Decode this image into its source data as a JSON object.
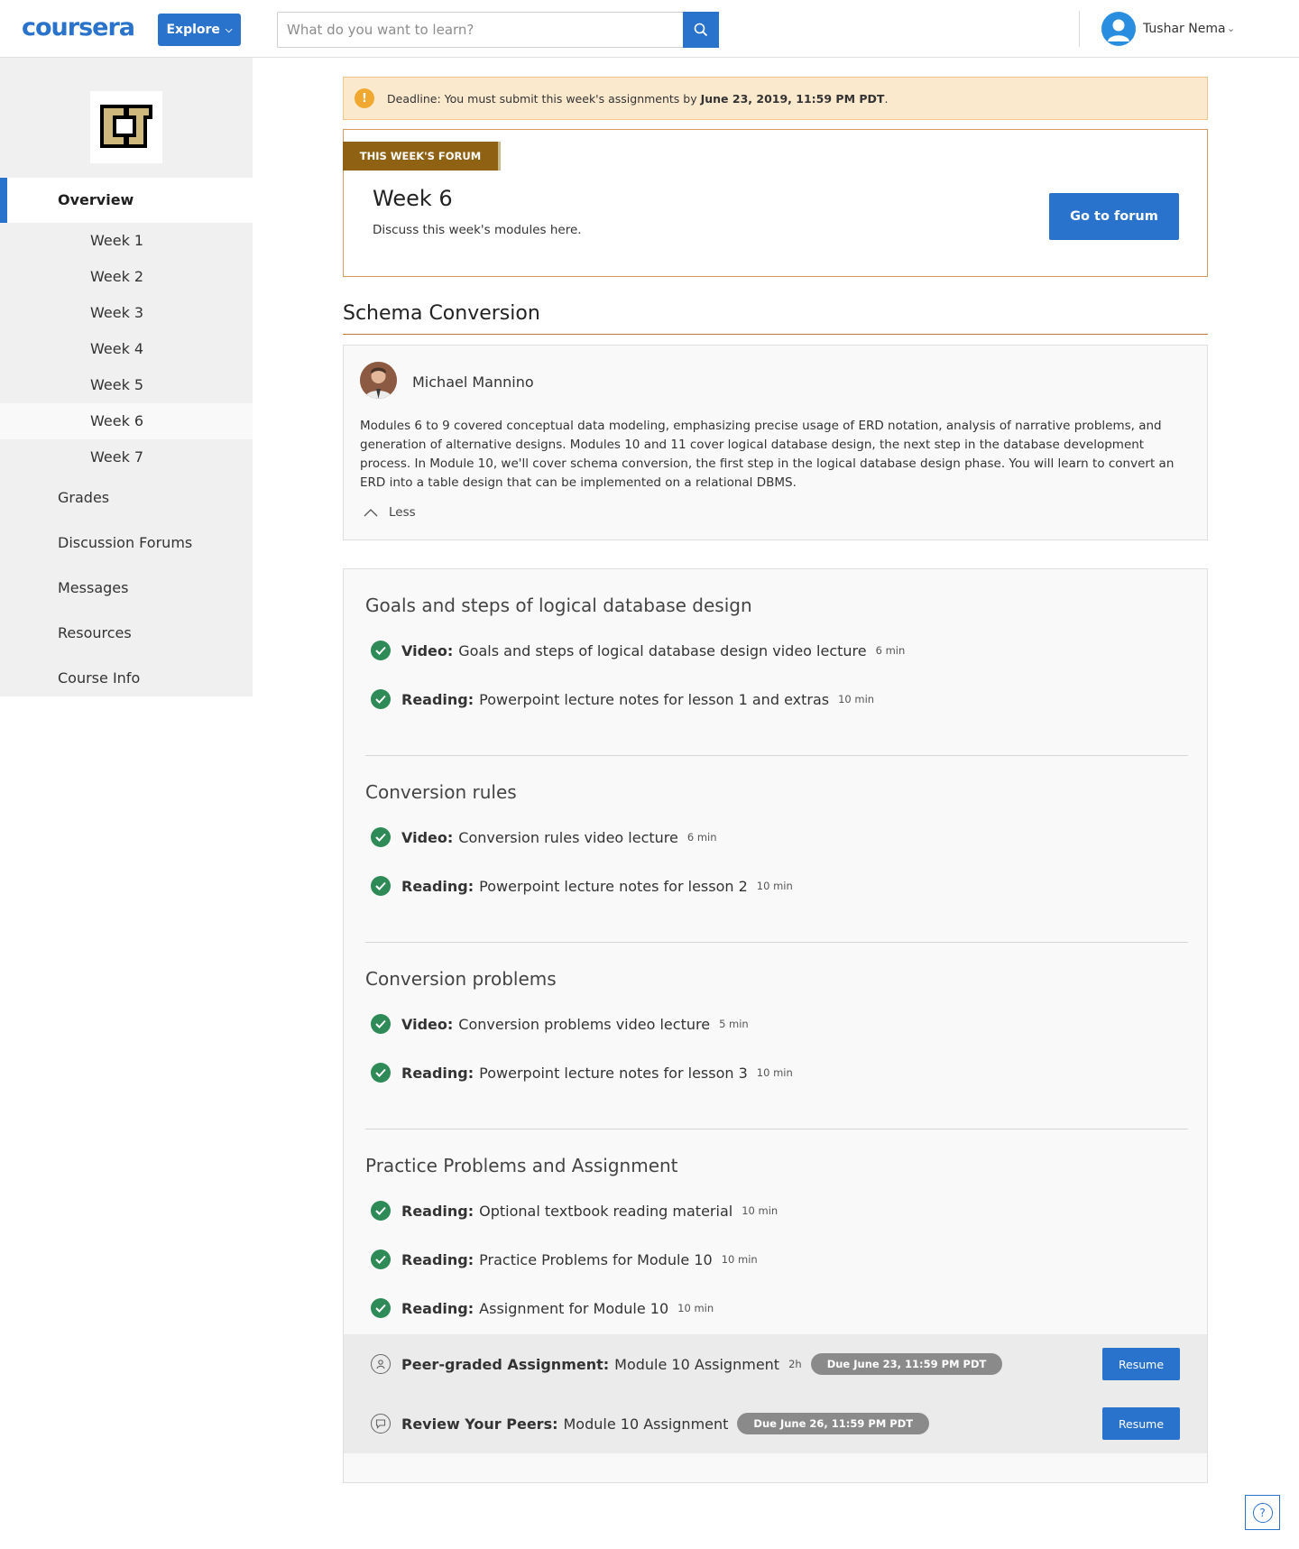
{
  "header": {
    "logo_text": "coursera",
    "explore_label": "Explore",
    "search_placeholder": "What do you want to learn?",
    "user_name": "Tushar Nema"
  },
  "sidebar": {
    "overview_label": "Overview",
    "weeks": [
      "Week 1",
      "Week 2",
      "Week 3",
      "Week 4",
      "Week 5",
      "Week 6",
      "Week 7"
    ],
    "active_week": "Week 6",
    "main_items": [
      "Grades",
      "Discussion Forums",
      "Messages",
      "Resources",
      "Course Info"
    ]
  },
  "deadline": {
    "prefix": "Deadline: You must submit this week's assignments by ",
    "date": "June 23, 2019, 11:59 PM PDT",
    "suffix": "."
  },
  "forum": {
    "ribbon": "THIS WEEK'S FORUM",
    "title": "Week 6",
    "description": "Discuss this week's modules here.",
    "button_label": "Go to forum"
  },
  "module": {
    "title": "Schema Conversion",
    "instructor_name": "Michael Mannino",
    "description": "Modules 6 to 9 covered conceptual data modeling, emphasizing precise usage of ERD notation, analysis of narrative problems, and generation of alternative designs. Modules 10 and 11 cover logical database design, the next step in the database development process. In Module 10, we'll cover schema conversion, the first step in the logical database design phase. You will learn to convert an ERD into a table design that can be implemented on a relational DBMS.",
    "toggle_label": "Less"
  },
  "lessons": [
    {
      "title": "Goals and steps of logical database design",
      "items": [
        {
          "type": "Video:",
          "name": "Goals and steps of logical database design video lecture",
          "duration": "6 min"
        },
        {
          "type": "Reading:",
          "name": "Powerpoint lecture notes for lesson 1 and extras",
          "duration": "10 min"
        }
      ]
    },
    {
      "title": "Conversion rules",
      "items": [
        {
          "type": "Video:",
          "name": "Conversion rules video lecture",
          "duration": "6 min"
        },
        {
          "type": "Reading:",
          "name": "Powerpoint lecture notes for lesson 2",
          "duration": "10 min"
        }
      ]
    },
    {
      "title": "Conversion problems",
      "items": [
        {
          "type": "Video:",
          "name": "Conversion problems video lecture",
          "duration": "5 min"
        },
        {
          "type": "Reading:",
          "name": "Powerpoint lecture notes for lesson 3",
          "duration": "10 min"
        }
      ]
    },
    {
      "title": "Practice Problems and Assignment",
      "items": [
        {
          "type": "Reading:",
          "name": "Optional textbook reading material",
          "duration": "10 min"
        },
        {
          "type": "Reading:",
          "name": "Practice Problems for Module 10",
          "duration": "10 min"
        },
        {
          "type": "Reading:",
          "name": "Assignment for Module 10",
          "duration": "10 min"
        }
      ]
    }
  ],
  "assignments": [
    {
      "type": "Peer-graded Assignment:",
      "name": "Module 10 Assignment",
      "duration": "2h",
      "due": "Due June 23, 11:59 PM PDT",
      "button": "Resume",
      "icon": "peer-graded-icon"
    },
    {
      "type": "Review Your Peers:",
      "name": "Module 10 Assignment",
      "duration": "",
      "due": "Due June 26, 11:59 PM PDT",
      "button": "Resume",
      "icon": "review-peers-icon"
    }
  ],
  "help": {
    "label": "?"
  },
  "colors": {
    "brand": "#2a73cc",
    "complete": "#2e8a57",
    "forum_ribbon": "#8e6113",
    "deadline_bg": "#fbe9ce"
  }
}
